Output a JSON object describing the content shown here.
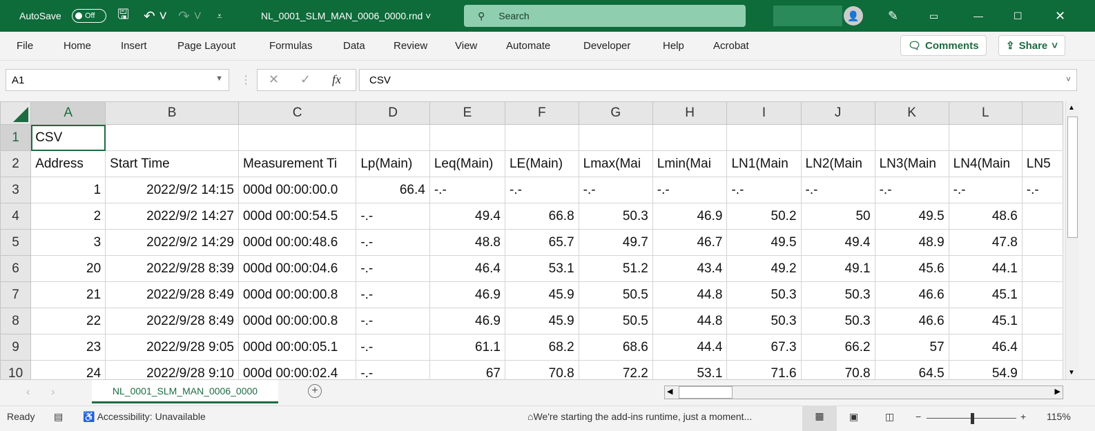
{
  "titlebar": {
    "autosave_label": "AutoSave",
    "autosave_state": "Off",
    "filename": "NL_0001_SLM_MAN_0006_0000.rnd",
    "search_placeholder": "Search"
  },
  "menu": [
    "File",
    "Home",
    "Insert",
    "Page Layout",
    "Formulas",
    "Data",
    "Review",
    "View",
    "Automate",
    "Developer",
    "Help",
    "Acrobat"
  ],
  "ribbon": {
    "comments": "Comments",
    "share": "Share"
  },
  "formula_bar": {
    "name_box": "A1",
    "formula": "CSV",
    "fx": "fx"
  },
  "sheet": {
    "columns": [
      "A",
      "B",
      "C",
      "D",
      "E",
      "F",
      "G",
      "H",
      "I",
      "J",
      "K",
      "L",
      ""
    ],
    "rows": [
      [
        "1",
        "CSV",
        "",
        "",
        "",
        "",
        "",
        "",
        "",
        "",
        "",
        "",
        "",
        ""
      ],
      [
        "2",
        "Address",
        "Start Time",
        "Measurement Ti",
        "Lp(Main)",
        "Leq(Main)",
        "LE(Main)",
        "Lmax(Mai",
        "Lmin(Mai",
        "LN1(Main",
        "LN2(Main",
        "LN3(Main",
        "LN4(Main",
        "LN5"
      ],
      [
        "3",
        "1",
        "2022/9/2 14:15",
        "000d 00:00:00.0",
        "66.4",
        "-.-",
        "-.-",
        "-.-",
        "-.-",
        "-.-",
        "-.-",
        "-.-",
        "-.-",
        "-.-"
      ],
      [
        "4",
        "2",
        "2022/9/2 14:27",
        "000d 00:00:54.5",
        "-.-",
        "49.4",
        "66.8",
        "50.3",
        "46.9",
        "50.2",
        "50",
        "49.5",
        "48.6",
        ""
      ],
      [
        "5",
        "3",
        "2022/9/2 14:29",
        "000d 00:00:48.6",
        "-.-",
        "48.8",
        "65.7",
        "49.7",
        "46.7",
        "49.5",
        "49.4",
        "48.9",
        "47.8",
        ""
      ],
      [
        "6",
        "20",
        "2022/9/28 8:39",
        "000d 00:00:04.6",
        "-.-",
        "46.4",
        "53.1",
        "51.2",
        "43.4",
        "49.2",
        "49.1",
        "45.6",
        "44.1",
        ""
      ],
      [
        "7",
        "21",
        "2022/9/28 8:49",
        "000d 00:00:00.8",
        "-.-",
        "46.9",
        "45.9",
        "50.5",
        "44.8",
        "50.3",
        "50.3",
        "46.6",
        "45.1",
        ""
      ],
      [
        "8",
        "22",
        "2022/9/28 8:49",
        "000d 00:00:00.8",
        "-.-",
        "46.9",
        "45.9",
        "50.5",
        "44.8",
        "50.3",
        "50.3",
        "46.6",
        "45.1",
        ""
      ],
      [
        "9",
        "23",
        "2022/9/28 9:05",
        "000d 00:00:05.1",
        "-.-",
        "61.1",
        "68.2",
        "68.6",
        "44.4",
        "67.3",
        "66.2",
        "57",
        "46.4",
        ""
      ],
      [
        "10",
        "24",
        "2022/9/28 9:10",
        "000d 00:00:02.4",
        "-.-",
        "67",
        "70.8",
        "72.2",
        "53.1",
        "71.6",
        "70.8",
        "64.5",
        "54.9",
        ""
      ]
    ]
  },
  "sheet_tab": "NL_0001_SLM_MAN_0006_0000",
  "status": {
    "ready": "Ready",
    "accessibility": "Accessibility: Unavailable",
    "message": "We're starting the add-ins runtime, just a moment...",
    "zoom": "115%"
  },
  "colors": {
    "brand": "#0e6b3a",
    "accent": "#1d6b40"
  }
}
